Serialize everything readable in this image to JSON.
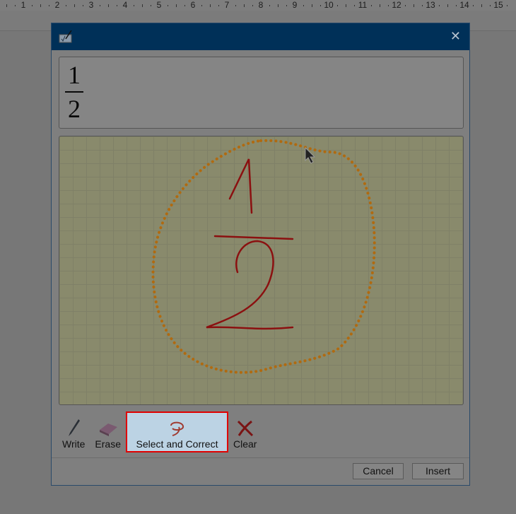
{
  "ruler": {
    "numbers": [
      "1",
      "2",
      "3",
      "4",
      "5",
      "6",
      "7",
      "8",
      "9",
      "10",
      "11",
      "12",
      "13",
      "14",
      "15"
    ]
  },
  "dialog": {
    "close_icon": "close-icon",
    "preview": {
      "numerator": "1",
      "denominator": "2"
    },
    "tools": [
      {
        "label": "Write",
        "icon": "pen-icon"
      },
      {
        "label": "Erase",
        "icon": "eraser-icon"
      },
      {
        "label": "Select and Correct",
        "icon": "lasso-icon",
        "active": true
      },
      {
        "label": "Clear",
        "icon": "clear-x-icon"
      }
    ],
    "cancel_label": "Cancel",
    "insert_label": "Insert"
  },
  "colors": {
    "titlebar": "#003058",
    "ink": "#8b1010",
    "selection": "#b06a10",
    "highlight": "#e00000"
  }
}
